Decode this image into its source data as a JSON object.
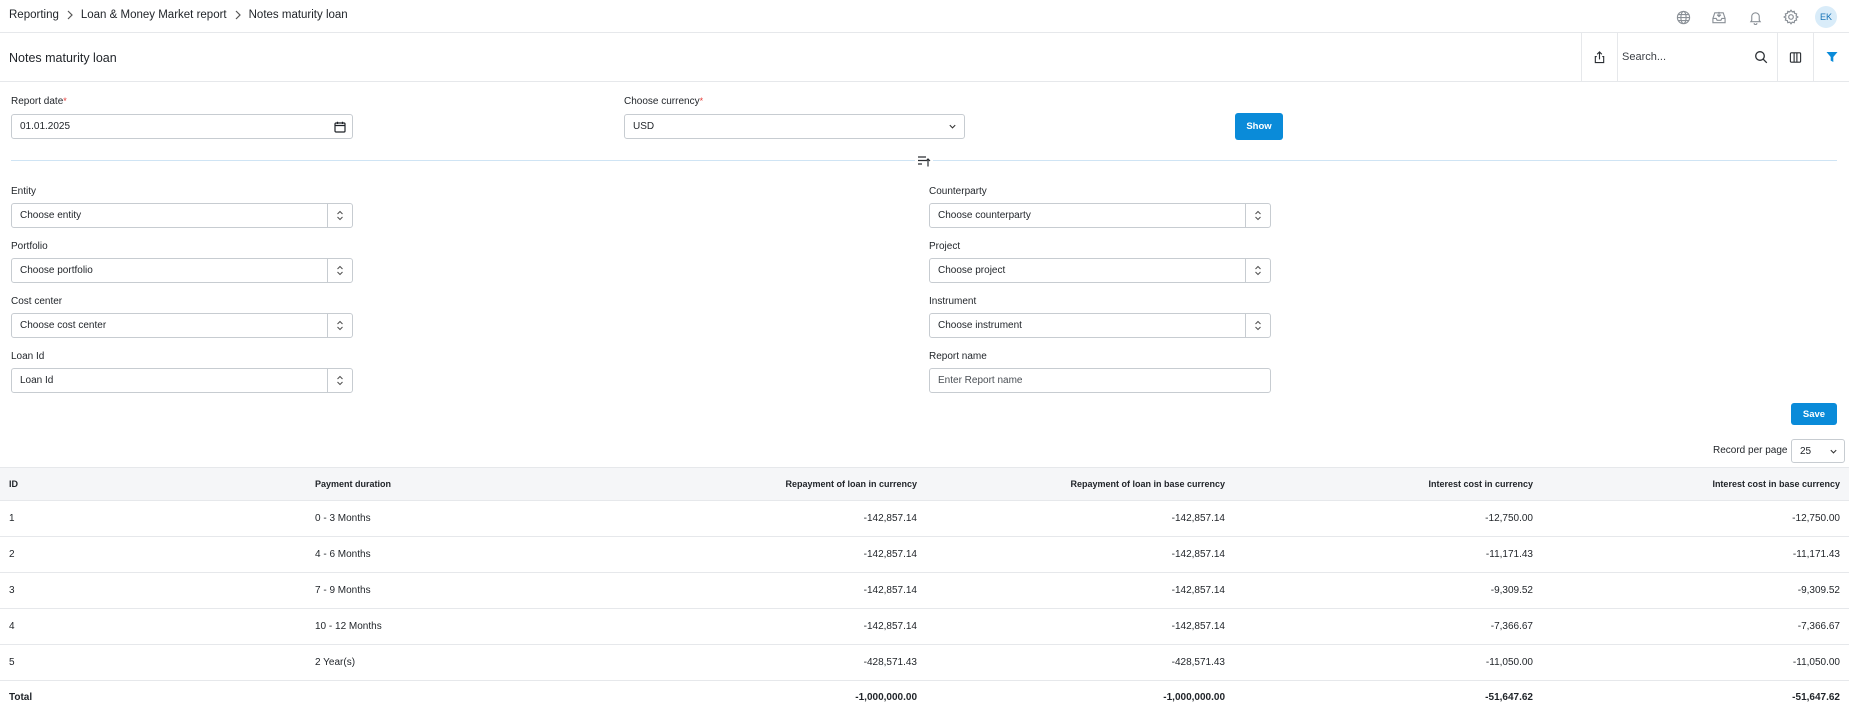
{
  "breadcrumb": [
    "Reporting",
    "Loan & Money Market report",
    "Notes maturity loan"
  ],
  "user": {
    "initials": "EK"
  },
  "header": {
    "title": "Notes maturity loan",
    "search_placeholder": "Search..."
  },
  "filters_top": {
    "report_date": {
      "label": "Report date",
      "value": "01.01.2025"
    },
    "currency": {
      "label": "Choose currency",
      "value": "USD"
    },
    "show_label": "Show"
  },
  "filters": {
    "entity": {
      "label": "Entity",
      "placeholder": "Choose entity"
    },
    "counterparty": {
      "label": "Counterparty",
      "placeholder": "Choose counterparty"
    },
    "portfolio": {
      "label": "Portfolio",
      "placeholder": "Choose portfolio"
    },
    "project": {
      "label": "Project",
      "placeholder": "Choose project"
    },
    "cost_center": {
      "label": "Cost center",
      "placeholder": "Choose cost center"
    },
    "instrument": {
      "label": "Instrument",
      "placeholder": "Choose instrument"
    },
    "loan_id": {
      "label": "Loan Id",
      "placeholder": "Loan Id"
    },
    "report_name": {
      "label": "Report name",
      "placeholder": "Enter Report name"
    }
  },
  "save_label": "Save",
  "pagination": {
    "label": "Record per page",
    "value": "25"
  },
  "table": {
    "columns": [
      "ID",
      "Payment duration",
      "Repayment of loan in currency",
      "Repayment of loan in base currency",
      "Interest cost in currency",
      "Interest cost in base currency"
    ],
    "rows": [
      [
        "1",
        "0 - 3 Months",
        "-142,857.14",
        "-142,857.14",
        "-12,750.00",
        "-12,750.00"
      ],
      [
        "2",
        "4 - 6 Months",
        "-142,857.14",
        "-142,857.14",
        "-11,171.43",
        "-11,171.43"
      ],
      [
        "3",
        "7 - 9 Months",
        "-142,857.14",
        "-142,857.14",
        "-9,309.52",
        "-9,309.52"
      ],
      [
        "4",
        "10 - 12 Months",
        "-142,857.14",
        "-142,857.14",
        "-7,366.67",
        "-7,366.67"
      ],
      [
        "5",
        "2 Year(s)",
        "-428,571.43",
        "-428,571.43",
        "-11,050.00",
        "-11,050.00"
      ]
    ],
    "total": [
      "Total",
      "",
      "-1,000,000.00",
      "-1,000,000.00",
      "-51,647.62",
      "-51,647.62"
    ]
  },
  "colors": {
    "accent": "#0a8bd9",
    "required": "#e53935",
    "divider": "#cfe4f4"
  },
  "icons": [
    "chevron-right-icon",
    "globe-icon",
    "inbox-icon",
    "bell-icon",
    "gear-icon",
    "export-icon",
    "search-icon",
    "columns-icon",
    "filter-icon",
    "calendar-icon",
    "chevron-down-icon",
    "stepper-icon",
    "collapse-filters-icon"
  ]
}
